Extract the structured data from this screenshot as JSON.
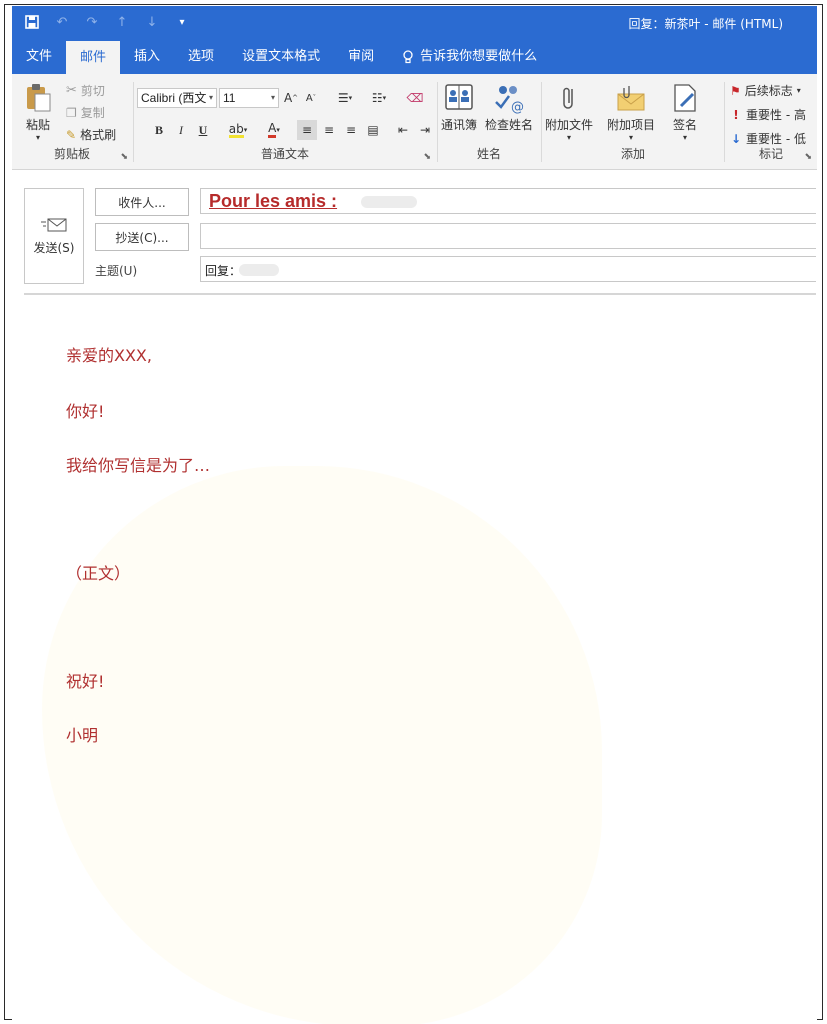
{
  "window": {
    "title": "回复：新茶叶  -  邮件 (HTML)"
  },
  "ribbon_tabs": [
    {
      "label": "文件",
      "active": false
    },
    {
      "label": "邮件",
      "active": true
    },
    {
      "label": "插入",
      "active": false
    },
    {
      "label": "选项",
      "active": false
    },
    {
      "label": "设置文本格式",
      "active": false
    },
    {
      "label": "审阅",
      "active": false
    }
  ],
  "tell_me": "告诉我你想要做什么",
  "clipboard": {
    "paste": "粘贴",
    "cut": "剪切",
    "copy": "复制",
    "format_painter": "格式刷",
    "group": "剪贴板"
  },
  "basic_text": {
    "font_name": "Calibri (西⽂",
    "font_size": "11",
    "bold": "B",
    "italic": "I",
    "underline": "U",
    "group": "普通文本"
  },
  "names": {
    "address_book": "通讯簿",
    "check_names": "检查姓名",
    "group": "姓名"
  },
  "include": {
    "attach_file": "附加文件",
    "attach_item": "附加项目",
    "signature": "签名",
    "group": "添加"
  },
  "tags": {
    "follow_up": "后续标志",
    "high_importance": "重要性 - 高",
    "low_importance": "重要性 - 低",
    "group": "标记"
  },
  "compose": {
    "send": "发送(S)",
    "to_button": "收件人...",
    "cc_button": "抄送(C)...",
    "subject_label": "主题(U)",
    "to_value": "Pour les amis :",
    "subject_value": "回复："
  },
  "body": {
    "greeting": "亲爱的XXX,",
    "hello": "你好!",
    "intro": "我给你写信是为了…",
    "main": "（正文）",
    "closing": "祝好!",
    "signature": "小明"
  },
  "colors": {
    "accent": "#2b6bd1",
    "body_text": "#b03030",
    "recipient": "#b62b2b"
  }
}
